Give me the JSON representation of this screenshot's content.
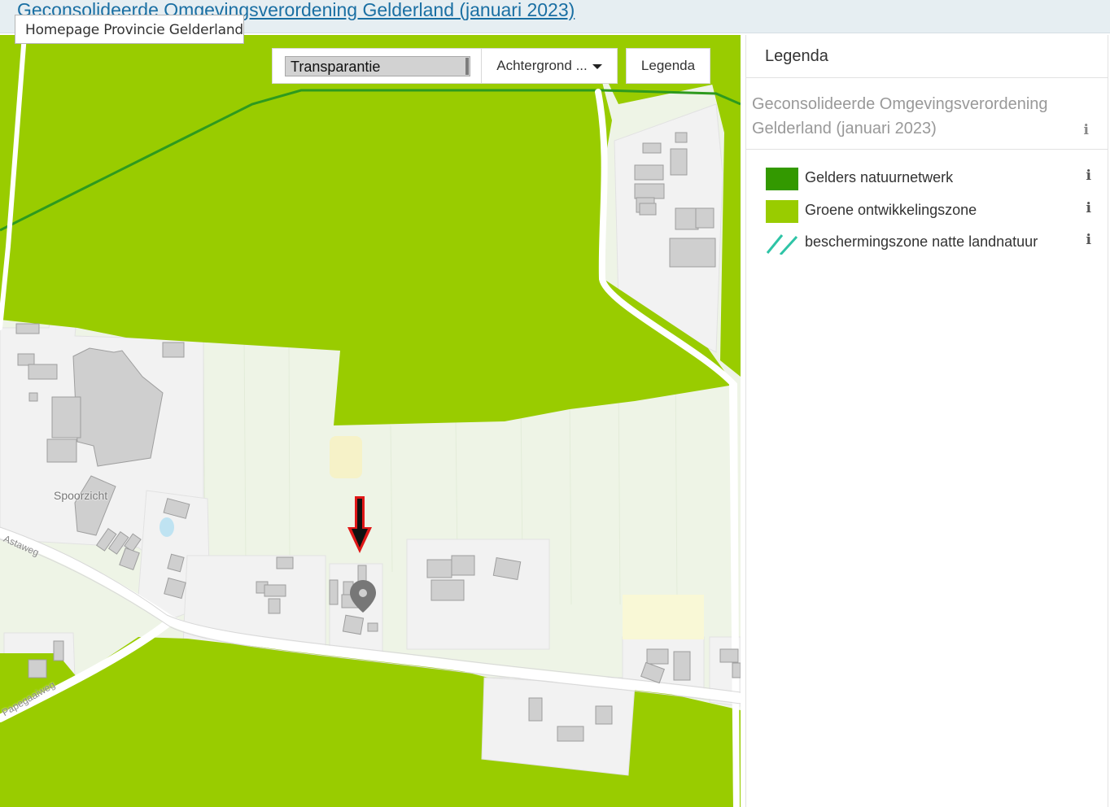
{
  "header": {
    "title": "Geconsolideerde Omgevingsverordening Gelderland (januari 2023)"
  },
  "tooltip": {
    "text": "Homepage Provincie Gelderland"
  },
  "toolbar": {
    "transparency_label": "Transparantie",
    "background_label": "Achtergrond ...",
    "legend_label": "Legenda"
  },
  "map": {
    "place_label": "Spoorzicht",
    "street_labels": [
      "Astaweg",
      "Papegaaiweg"
    ],
    "marker_icon": "map-pin-icon",
    "annotation_icon": "red-down-arrow-icon"
  },
  "legend": {
    "header": "Legenda",
    "layer_title": "Geconsolideerde Omgevingsverordening Gelderland (januari 2023)",
    "info_glyph": "i",
    "items": [
      {
        "label": "Gelders natuurnetwerk",
        "color": "#339900",
        "symbol": "fill"
      },
      {
        "label": "Groene ontwikkelingszone",
        "color": "#99cc00",
        "symbol": "fill"
      },
      {
        "label": "beschermingszone natte landnatuur",
        "color": "#2ec4a6",
        "symbol": "hatch"
      }
    ]
  }
}
